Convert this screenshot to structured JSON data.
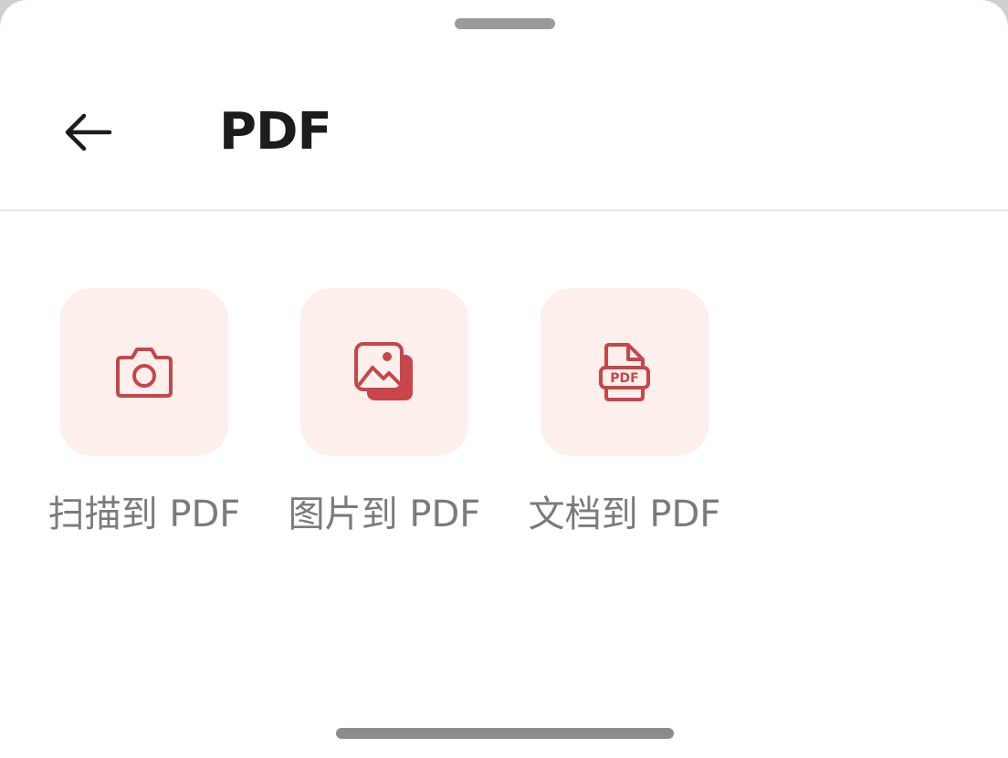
{
  "header": {
    "title": "PDF",
    "back_icon": "arrow-left-icon"
  },
  "actions": [
    {
      "label": "扫描到 PDF",
      "icon": "camera-icon"
    },
    {
      "label": "图片到 PDF",
      "icon": "image-stack-icon"
    },
    {
      "label": "文档到 PDF",
      "icon": "pdf-document-icon"
    }
  ],
  "colors": {
    "accent": "#c8454a",
    "tile_background": "#fdf0ec",
    "title_text": "#1c1c1c",
    "label_text": "#7b7b7b"
  }
}
